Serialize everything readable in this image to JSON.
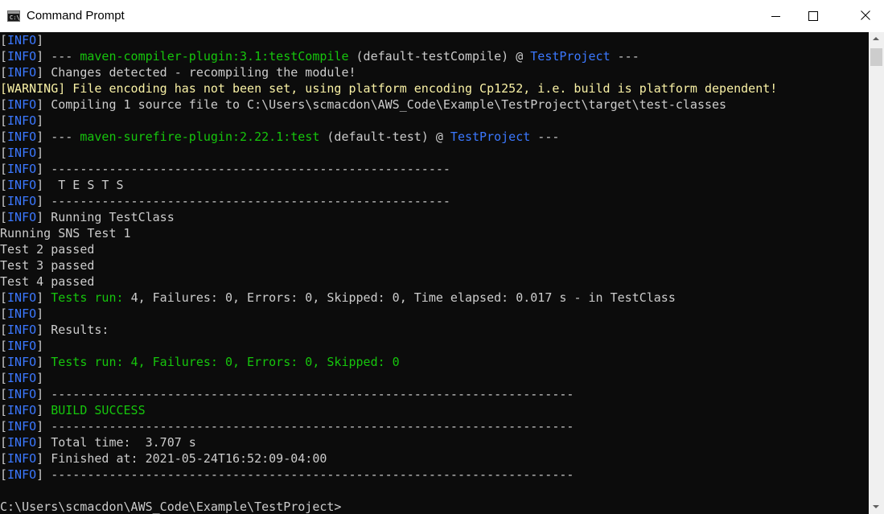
{
  "window": {
    "title": "Command Prompt",
    "icon": "cmd-icon",
    "icon_glyph": "C:\\_",
    "minimize_icon": "minimize-icon",
    "maximize_icon": "maximize-icon",
    "close_icon": "close-icon"
  },
  "colors": {
    "console_bg": "#0c0c0c",
    "default_text": "#cccccc",
    "info_label": "#3b78ff",
    "warning": "#f9f1a5",
    "green": "#16c60c",
    "blue": "#3b78ff"
  },
  "console": {
    "lines": [
      {
        "level": "INFO",
        "segments": []
      },
      {
        "level": "INFO",
        "segments": [
          {
            "text": " --- ",
            "color": "white"
          },
          {
            "text": "maven-compiler-plugin:3.1:testCompile",
            "color": "green"
          },
          {
            "text": " (default-testCompile) @ ",
            "color": "white"
          },
          {
            "text": "TestProject",
            "color": "blue"
          },
          {
            "text": " ---",
            "color": "white"
          }
        ]
      },
      {
        "level": "INFO",
        "segments": [
          {
            "text": " Changes detected - recompiling the module!",
            "color": "white"
          }
        ]
      },
      {
        "level": "WARNING",
        "segments": [
          {
            "text": " File encoding has not been set, using platform encoding Cp1252, i.e. build is platform dependent!",
            "color": "warn"
          }
        ]
      },
      {
        "level": "INFO",
        "segments": [
          {
            "text": " Compiling 1 source file to C:\\Users\\scmacdon\\AWS_Code\\Example\\TestProject\\target\\test-classes",
            "color": "white"
          }
        ]
      },
      {
        "level": "INFO",
        "segments": []
      },
      {
        "level": "INFO",
        "segments": [
          {
            "text": " --- ",
            "color": "white"
          },
          {
            "text": "maven-surefire-plugin:2.22.1:test",
            "color": "green"
          },
          {
            "text": " (default-test) @ ",
            "color": "white"
          },
          {
            "text": "TestProject",
            "color": "blue"
          },
          {
            "text": " ---",
            "color": "white"
          }
        ]
      },
      {
        "level": "INFO",
        "segments": []
      },
      {
        "level": "INFO",
        "segments": [
          {
            "text": " -------------------------------------------------------",
            "color": "white"
          }
        ]
      },
      {
        "level": "INFO",
        "segments": [
          {
            "text": "  T E S T S",
            "color": "white"
          }
        ]
      },
      {
        "level": "INFO",
        "segments": [
          {
            "text": " -------------------------------------------------------",
            "color": "white"
          }
        ]
      },
      {
        "level": "INFO",
        "segments": [
          {
            "text": " Running TestClass",
            "color": "white"
          }
        ]
      },
      {
        "level": "",
        "segments": [
          {
            "text": "Running SNS Test 1",
            "color": "white"
          }
        ]
      },
      {
        "level": "",
        "segments": [
          {
            "text": "Test 2 passed",
            "color": "white"
          }
        ]
      },
      {
        "level": "",
        "segments": [
          {
            "text": "Test 3 passed",
            "color": "white"
          }
        ]
      },
      {
        "level": "",
        "segments": [
          {
            "text": "Test 4 passed",
            "color": "white"
          }
        ]
      },
      {
        "level": "INFO",
        "segments": [
          {
            "text": " ",
            "color": "white"
          },
          {
            "text": "Tests run: ",
            "color": "green"
          },
          {
            "text": "4, Failures: 0, Errors: 0, Skipped: 0, Time elapsed: 0.017 s - in TestClass",
            "color": "white"
          }
        ]
      },
      {
        "level": "INFO",
        "segments": []
      },
      {
        "level": "INFO",
        "segments": [
          {
            "text": " Results:",
            "color": "white"
          }
        ]
      },
      {
        "level": "INFO",
        "segments": []
      },
      {
        "level": "INFO",
        "segments": [
          {
            "text": " ",
            "color": "white"
          },
          {
            "text": "Tests run: 4, Failures: 0, Errors: 0, Skipped: 0",
            "color": "green"
          }
        ]
      },
      {
        "level": "INFO",
        "segments": []
      },
      {
        "level": "INFO",
        "segments": [
          {
            "text": " ------------------------------------------------------------------------",
            "color": "white"
          }
        ]
      },
      {
        "level": "INFO",
        "segments": [
          {
            "text": " ",
            "color": "white"
          },
          {
            "text": "BUILD SUCCESS",
            "color": "green"
          }
        ]
      },
      {
        "level": "INFO",
        "segments": [
          {
            "text": " ------------------------------------------------------------------------",
            "color": "white"
          }
        ]
      },
      {
        "level": "INFO",
        "segments": [
          {
            "text": " Total time:  3.707 s",
            "color": "white"
          }
        ]
      },
      {
        "level": "INFO",
        "segments": [
          {
            "text": " Finished at: 2021-05-24T16:52:09-04:00",
            "color": "white"
          }
        ]
      },
      {
        "level": "INFO",
        "segments": [
          {
            "text": " ------------------------------------------------------------------------",
            "color": "white"
          }
        ]
      },
      {
        "level": "",
        "segments": []
      },
      {
        "level": "",
        "segments": [
          {
            "text": "C:\\Users\\scmacdon\\AWS_Code\\Example\\TestProject>",
            "color": "white"
          }
        ]
      }
    ]
  },
  "scrollbar": {
    "up_icon": "scroll-up-arrow-icon",
    "down_icon": "scroll-down-arrow-icon"
  }
}
